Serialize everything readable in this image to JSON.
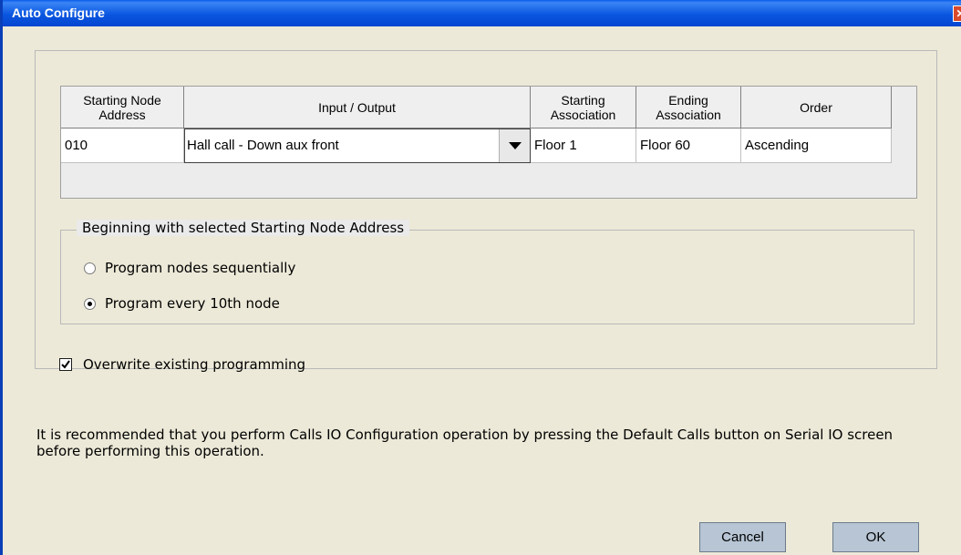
{
  "window": {
    "title": "Auto Configure",
    "close_glyph": "✕"
  },
  "grid": {
    "headers": [
      "Starting Node Address",
      "Input / Output",
      "Starting Association",
      "Ending Association",
      "Order"
    ],
    "row": {
      "starting_node_address": "010",
      "input_output": "Hall call - Down aux front",
      "starting_association": "Floor 1",
      "ending_association": "Floor 60",
      "order": "Ascending"
    }
  },
  "beginning_group": {
    "legend": "Beginning with selected Starting Node Address",
    "options": [
      {
        "label": "Program nodes sequentially",
        "selected": false
      },
      {
        "label": "Program every 10th node",
        "selected": true
      }
    ]
  },
  "overwrite": {
    "label": "Overwrite existing programming",
    "checked": true
  },
  "note": "It is recommended that you perform Calls IO Configuration operation by pressing the Default Calls button on Serial IO screen before performing this operation.",
  "buttons": {
    "cancel": "Cancel",
    "ok": "OK"
  },
  "icons": {
    "dropdown": "chevron-down-icon",
    "close": "close-icon",
    "check": "check-icon"
  },
  "colors": {
    "titlebar": "#0A56E0",
    "button_face": "#B7C5D4",
    "background": "#EAEAEA"
  }
}
